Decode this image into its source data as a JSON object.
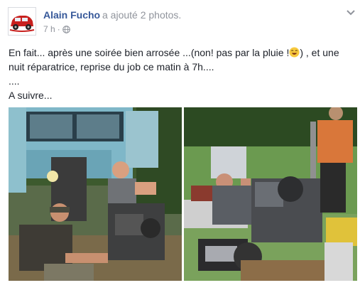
{
  "post": {
    "author": "Alain Fucho",
    "action": "a ajouté 2 photos.",
    "time": "7 h",
    "separator": "·",
    "privacy_icon": "globe-icon",
    "menu_icon": "chevron-down-icon"
  },
  "text": {
    "line1_before_emoji": "En fait... après une soirée bien arrosée ...(non! pas par la pluie !",
    "emoji": "laughing-emoji",
    "line1_after_emoji": ") , et une nuit réparatrice, reprise du job ce matin à 7h....",
    "line2": "....",
    "line3": "A suivre..."
  },
  "photos": [
    {
      "name": "photo-citroen-engine-workers",
      "subject": "van with removed engine and two workers"
    },
    {
      "name": "photo-engine-on-pallet",
      "subject": "engine on pallet in garden"
    }
  ],
  "colors": {
    "link": "#365899",
    "meta": "#90949c",
    "text": "#1d2129"
  }
}
